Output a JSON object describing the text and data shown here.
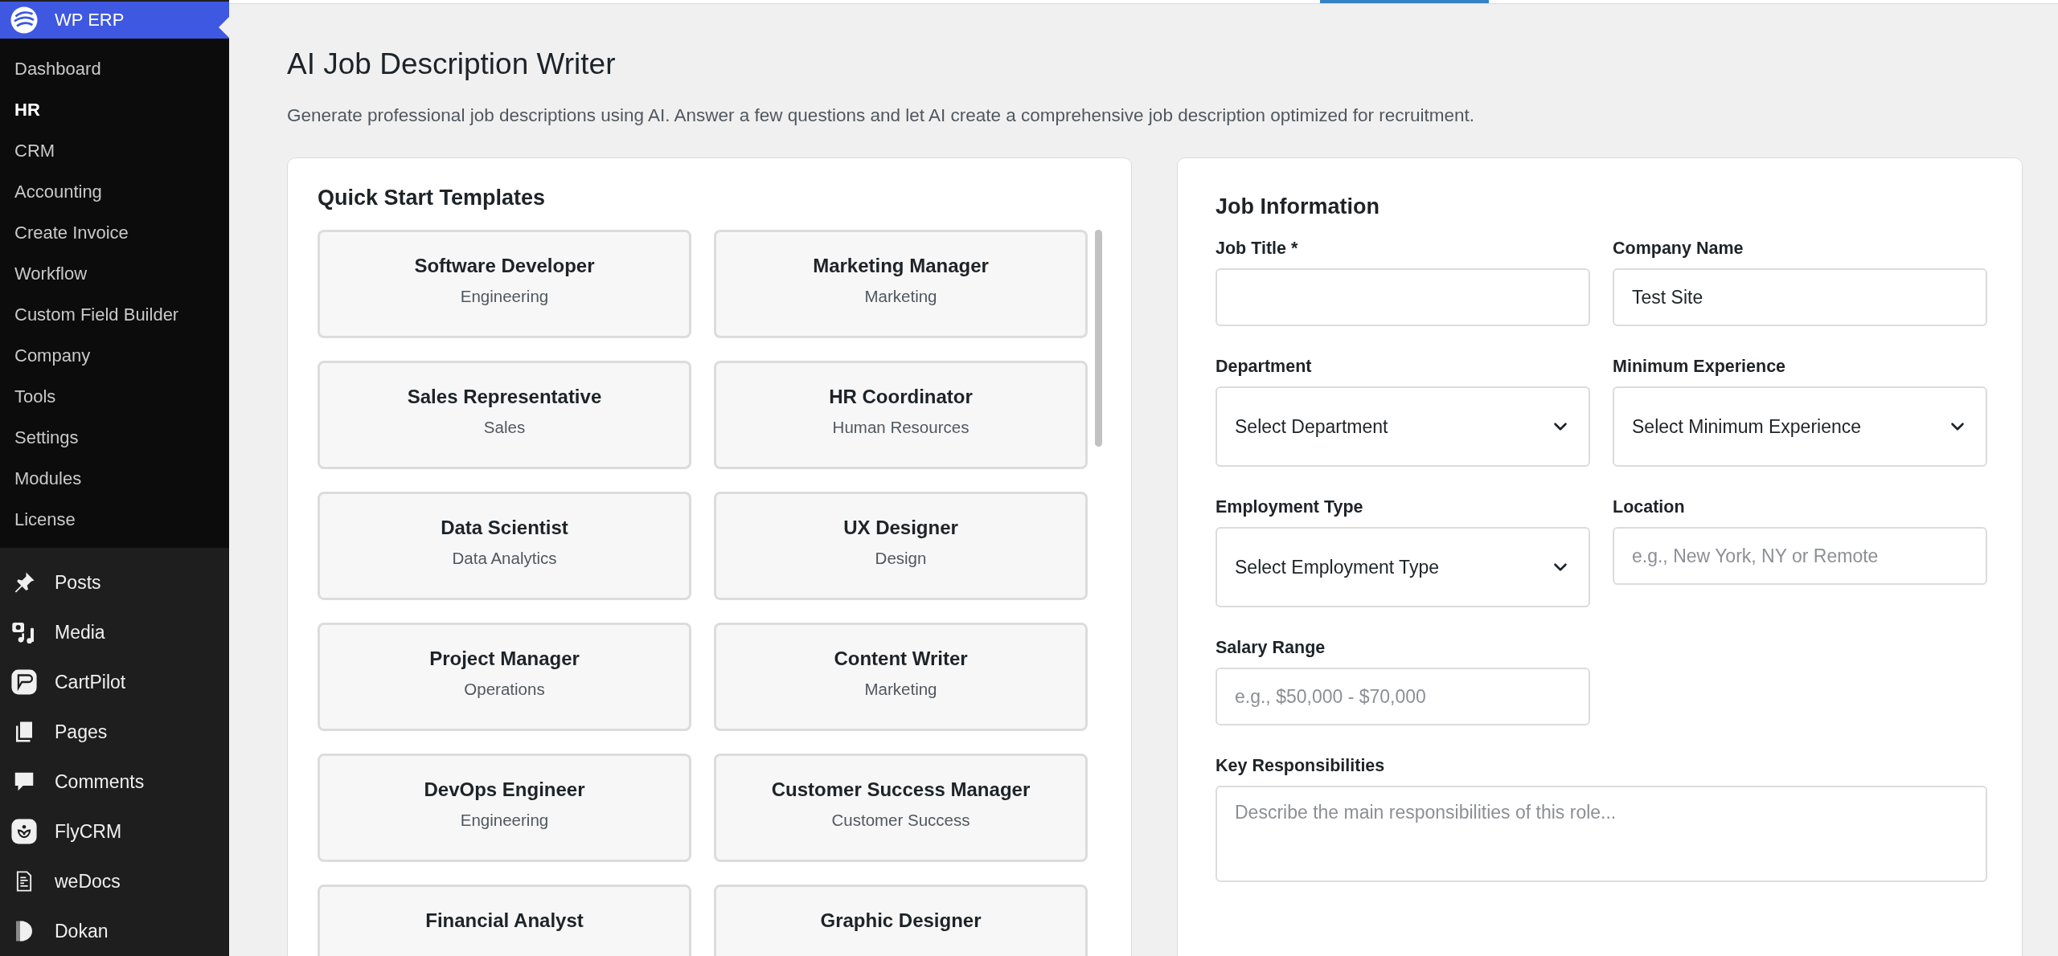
{
  "sidebar": {
    "brand": "WP ERP",
    "submenu": [
      {
        "label": "Dashboard",
        "selected": false
      },
      {
        "label": "HR",
        "selected": true
      },
      {
        "label": "CRM",
        "selected": false
      },
      {
        "label": "Accounting",
        "selected": false
      },
      {
        "label": "Create Invoice",
        "selected": false
      },
      {
        "label": "Workflow",
        "selected": false
      },
      {
        "label": "Custom Field Builder",
        "selected": false
      },
      {
        "label": "Company",
        "selected": false
      },
      {
        "label": "Tools",
        "selected": false
      },
      {
        "label": "Settings",
        "selected": false
      },
      {
        "label": "Modules",
        "selected": false
      },
      {
        "label": "License",
        "selected": false
      }
    ],
    "menu": [
      {
        "label": "Posts"
      },
      {
        "label": "Media"
      },
      {
        "label": "CartPilot"
      },
      {
        "label": "Pages"
      },
      {
        "label": "Comments"
      },
      {
        "label": "FlyCRM"
      },
      {
        "label": "weDocs"
      },
      {
        "label": "Dokan"
      }
    ]
  },
  "page": {
    "title": "AI Job Description Writer",
    "subtitle": "Generate professional job descriptions using AI. Answer a few questions and let AI create a comprehensive job description optimized for recruitment."
  },
  "templates": {
    "title": "Quick Start Templates",
    "items": [
      {
        "name": "Software Developer",
        "category": "Engineering"
      },
      {
        "name": "Marketing Manager",
        "category": "Marketing"
      },
      {
        "name": "Sales Representative",
        "category": "Sales"
      },
      {
        "name": "HR Coordinator",
        "category": "Human Resources"
      },
      {
        "name": "Data Scientist",
        "category": "Data Analytics"
      },
      {
        "name": "UX Designer",
        "category": "Design"
      },
      {
        "name": "Project Manager",
        "category": "Operations"
      },
      {
        "name": "Content Writer",
        "category": "Marketing"
      },
      {
        "name": "DevOps Engineer",
        "category": "Engineering"
      },
      {
        "name": "Customer Success Manager",
        "category": "Customer Success"
      },
      {
        "name": "Financial Analyst"
      },
      {
        "name": "Graphic Designer"
      }
    ]
  },
  "form": {
    "title": "Job Information",
    "fields": [
      {
        "kind": "text",
        "label": "Job Title *"
      },
      {
        "kind": "text",
        "label": "Company Name",
        "value": "Test Site"
      },
      {
        "kind": "select",
        "label": "Department",
        "value": "Select Department"
      },
      {
        "kind": "select",
        "label": "Minimum Experience",
        "value": "Select Minimum Experience"
      },
      {
        "kind": "select",
        "label": "Employment Type",
        "value": "Select Employment Type"
      },
      {
        "kind": "text",
        "label": "Location",
        "placeholder": "e.g., New York, NY or Remote"
      },
      {
        "kind": "text",
        "label": "Salary Range",
        "placeholder": "e.g., $50,000 - $70,000"
      },
      {
        "kind": "spacer"
      },
      {
        "kind": "textarea",
        "label": "Key Responsibilities",
        "placeholder": "Describe the main responsibilities of this role..."
      }
    ]
  }
}
